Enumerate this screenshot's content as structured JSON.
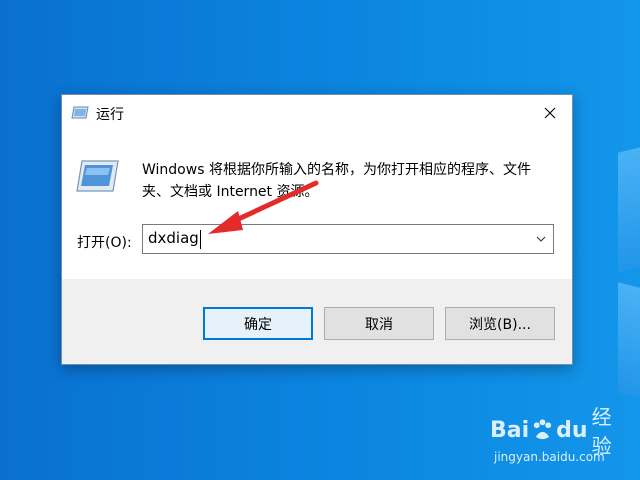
{
  "dialog": {
    "title": "运行",
    "description": "Windows 将根据你所输入的名称，为你打开相应的程序、文件夹、文档或 Internet 资源。",
    "open_label": "打开(O):",
    "open_value": "dxdiag",
    "buttons": {
      "ok": "确定",
      "cancel": "取消",
      "browse": "浏览(B)..."
    }
  },
  "watermark": {
    "logo_left": "Bai",
    "logo_right": "du",
    "logo_suffix": "经验",
    "url": "jingyan.baidu.com"
  },
  "colors": {
    "desktop": "#0b86e0",
    "accent": "#0078d7",
    "annotation_arrow": "#e32b2b"
  },
  "icons": {
    "title": "run-app-icon",
    "close": "close-icon",
    "dropdown": "chevron-down-icon"
  }
}
